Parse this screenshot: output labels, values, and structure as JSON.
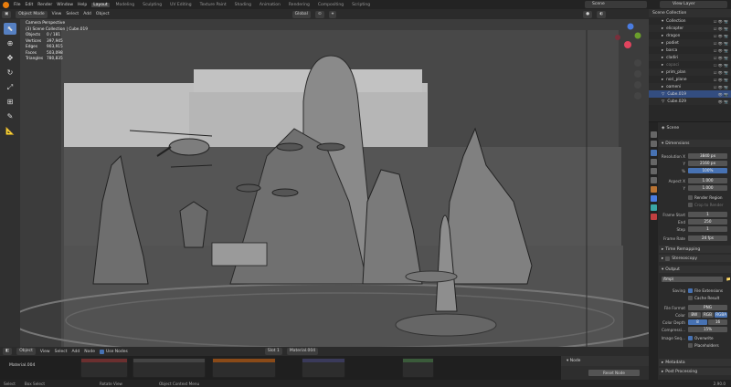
{
  "topbar": {
    "menus": [
      "File",
      "Edit",
      "Render",
      "Window",
      "Help"
    ],
    "workspaces": [
      "Layout",
      "Modeling",
      "Sculpting",
      "UV Editing",
      "Texture Paint",
      "Shading",
      "Animation",
      "Rendering",
      "Compositing",
      "Scripting"
    ],
    "active_workspace": "Layout",
    "scene": "Scene",
    "view_layer": "View Layer"
  },
  "viewport_header": {
    "mode": "Object Mode",
    "menus": [
      "View",
      "Select",
      "Add",
      "Object"
    ],
    "orientation": "Global"
  },
  "overlay": {
    "view_name": "Camera Perspective",
    "collection": "(3) Scene Collection | Cube.019",
    "stats": [
      {
        "label": "Objects",
        "value": "0 / 181"
      },
      {
        "label": "Vertices",
        "value": "397,945"
      },
      {
        "label": "Edges",
        "value": "903,915"
      },
      {
        "label": "Faces",
        "value": "503,098"
      },
      {
        "label": "Triangles",
        "value": "780,835"
      }
    ]
  },
  "outliner": {
    "header": "Scene Collection",
    "items": [
      "Collection",
      "elicopter",
      "dragon",
      "podiet",
      "barca",
      "cladiri",
      "copaci",
      "prim_plan",
      "nori_plane",
      "oameni",
      "Cube.019",
      "Cube.029"
    ],
    "selected_index": 10
  },
  "properties": {
    "section_dimensions": "Dimensions",
    "resolution_label": "Resolution X",
    "res_x": "3840 px",
    "y_label": "Y",
    "res_y": "2160 px",
    "pct_label": "%",
    "res_pct": "100%",
    "aspect_label": "Aspect X",
    "aspect_x": "1.000",
    "aspect_y": "1.000",
    "render_region": "Render Region",
    "crop": "Crop to Render",
    "frame_start_label": "Frame Start",
    "frame_start": "1",
    "end_label": "End",
    "frame_end": "250",
    "step_label": "Step",
    "frame_step": "1",
    "frame_rate_label": "Frame Rate",
    "frame_rate": "24 fps",
    "time_remap": "Time Remapping",
    "stereoscopy": "Stereoscopy",
    "section_output": "Output",
    "output_path": "/tmp\\",
    "saving_label": "Saving",
    "file_ext": "File Extensions",
    "cache_result": "Cache Result",
    "file_format_label": "File Format",
    "file_format": "PNG",
    "color_label": "Color",
    "color_opts": [
      "BW",
      "RGB",
      "RGBA"
    ],
    "color_depth_label": "Color Depth",
    "color_depth": [
      "8",
      "16"
    ],
    "compression_label": "Compressi...",
    "compression": "15%",
    "image_seq_label": "Image Seq...",
    "overwrite": "Overwrite",
    "placeholders": "Placeholders",
    "metadata": "Metadata",
    "post_processing": "Post Processing",
    "scene_label": "Scene"
  },
  "node_editor": {
    "type": "Object",
    "menus": [
      "View",
      "Select",
      "Add",
      "Node"
    ],
    "use_nodes": "Use Nodes",
    "slot": "Slot 1",
    "material": "Material.004",
    "left_label": "Material.004",
    "panel_title": "Node",
    "reset": "Reset Node"
  },
  "statusbar": {
    "items": [
      "Select",
      "Box Select",
      "Rotate View",
      "Object Context Menu"
    ],
    "version": "2.90.0"
  },
  "icons": [
    "cursor-icon",
    "move-icon",
    "rotate-icon",
    "scale-icon",
    "transform-icon",
    "annotate-icon",
    "measure-icon"
  ]
}
